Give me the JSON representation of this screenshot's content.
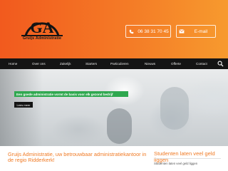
{
  "brand": {
    "logo_letters": "GA",
    "name": "Gruijs Administratie"
  },
  "contact": {
    "phone_label": "06 38 31 70 45",
    "email_label": "E-mail"
  },
  "nav": {
    "items": [
      "Home",
      "Over ons",
      "Zakelijk",
      "Starters",
      "Particulieren",
      "Nieuws",
      "Offerte",
      "Contact"
    ]
  },
  "hero": {
    "banner_text": "Een goede administratie vormt de basis voor elk gezond bedrijf",
    "button_label": "Lees meer"
  },
  "intro": {
    "text": "Gruijs Administratie, uw betrouwbaar administratiekantoor in de regio Ridderkerk!"
  },
  "sidebar": {
    "title": "Studenten laten veel geld liggen",
    "items": [
      "Studenten laten veel geld liggen"
    ]
  },
  "colors": {
    "accent": "#f07a24",
    "nav_bg": "#141414",
    "banner_green": "#2fa84f"
  }
}
